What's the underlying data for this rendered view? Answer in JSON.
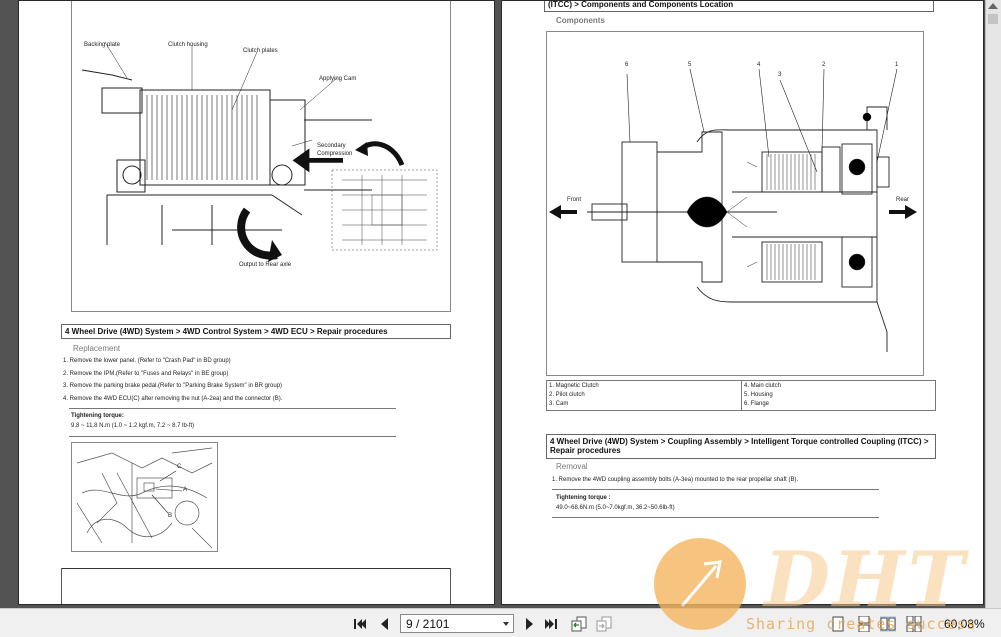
{
  "left_page": {
    "figure_labels": {
      "backing_plate": "Backing plate",
      "clutch_housing": "Clutch housing",
      "clutch_plates": "Clutch plates",
      "applying_cam": "Applying Cam",
      "secondary_compression": "Secondary\nCompression",
      "output_rear_axle": "Output to Rear axle"
    },
    "section_header": "4 Wheel Drive (4WD) System > 4WD Control System > 4WD ECU > Repair procedures",
    "sub_title": "Replacement",
    "steps": [
      "1. Remove the lower panel. (Refer to \"Crash Pad\" in BD group)",
      "2. Remove the IPM.(Refer to \"Fuses and Relays\" in BE group)",
      "3. Remove the parking brake pedal.(Refer to \"Parking Brake System\" in BR group)",
      "4. Remove the 4WD ECU(C) after removing the nut (A-2ea) and the connector (B)."
    ],
    "torque_label": "Tightening torque:",
    "torque_value": "9.8 ~ 11.8 N.m (1.0 ~ 1.2 kgf.m, 7.2 ~ 8.7 lb-ft)",
    "photo_labels": {
      "a": "A",
      "b": "B",
      "c": "C"
    }
  },
  "right_page": {
    "top_header": "(ITCC) > Components and Components Location",
    "sub_title": "Components",
    "diagram_numbers": [
      "6",
      "5",
      "4",
      "3",
      "2",
      "1"
    ],
    "front_label": "Front",
    "rear_label": "Rear",
    "legend": [
      "1. Magnetic Clutch",
      "4. Main clutch",
      "2. Pilot clutch",
      "5. Housing",
      "3. Cam",
      "6. Flange"
    ],
    "section_header": "4 Wheel Drive (4WD) System > Coupling Assembly > Intelligent Torque controlled Coupling (ITCC) > Repair procedures",
    "sub_title2": "Removal",
    "step": "1. Remove the 4WD coupling assembly bolts (A-3ea) mounted to the rear propellar shaft (B).",
    "torque_label": "Tightening torque :",
    "torque_value": "49.0~68.6N.m (5.0~7.0kgf.m, 36.2~50.6lb-ft)"
  },
  "toolbar": {
    "page_indicator": "9 / 2101",
    "zoom": "60,08%",
    "icons": [
      "first-page-icon",
      "prev-page-icon",
      "next-page-icon",
      "last-page-icon",
      "go-back-icon",
      "go-forward-icon",
      "single-page-icon",
      "continuous-icon",
      "facing-icon",
      "facing-continuous-icon"
    ]
  },
  "watermark": {
    "logo_text": "DHT",
    "tagline": "Sharing creates success"
  }
}
